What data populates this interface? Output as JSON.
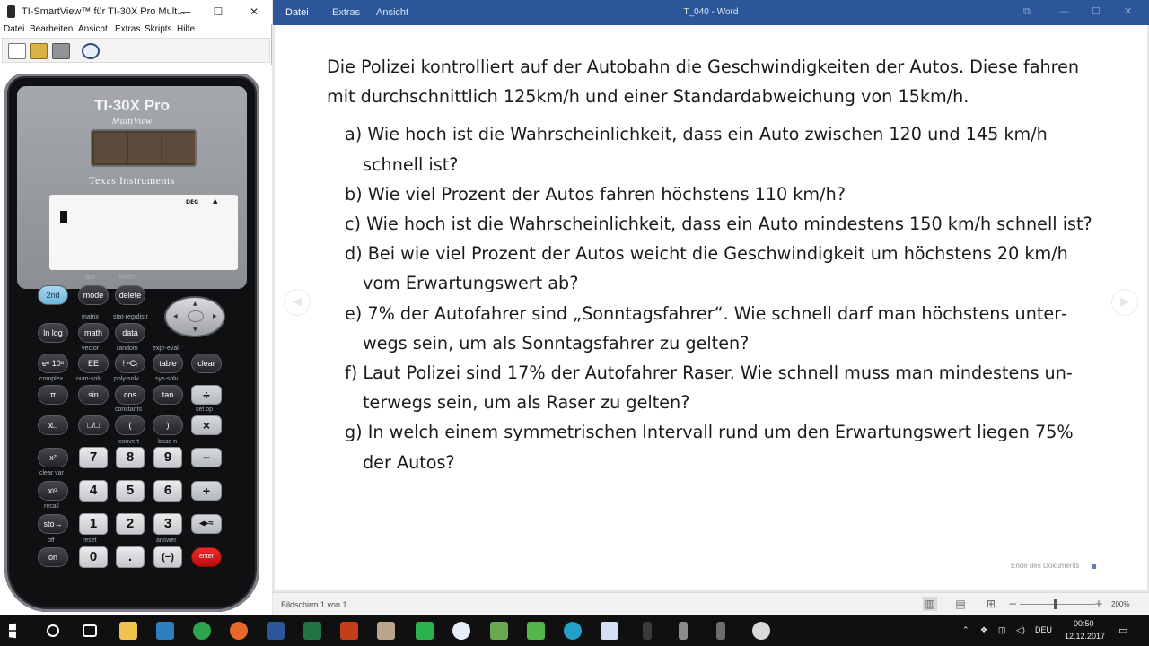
{
  "ti": {
    "title": "TI-SmartView™ für TI-30X Pro Mult...",
    "menus": [
      "Datei",
      "Bearbeiten",
      "Ansicht",
      "Extras",
      "Skripts",
      "Hilfe"
    ],
    "calculator": {
      "model": "TI-30X Pro",
      "submodel": "MultiView",
      "brand": "Texas Instruments",
      "display_mode": "DEG",
      "keys": {
        "k2nd": "2nd",
        "mode": "mode",
        "delete": "delete",
        "ln": "ln log",
        "math": "math",
        "data": "data",
        "exp": "eᵒ 10ᵒ",
        "ee": "EE",
        "table": "table",
        "clear": "clear",
        "pi": "π",
        "sin": "sin",
        "cos": "cos",
        "tan": "tan",
        "divide": "÷",
        "xpow": "x□",
        "frac": "□/□",
        "lparen": "(",
        "rparen": ")",
        "multiply": "×",
        "x2": "x²",
        "n7": "7",
        "n8": "8",
        "n9": "9",
        "minus": "−",
        "xyz": "xʸᶻ",
        "n4": "4",
        "n5": "5",
        "n6": "6",
        "plus": "+",
        "sto": "sto→",
        "n1": "1",
        "n2": "2",
        "n3": "3",
        "toggle": "◂▸≈",
        "on": "on",
        "n0": "0",
        "dot": ".",
        "neg": "(−)",
        "enter": "enter"
      },
      "second_labels": {
        "quit": "quit",
        "insert": "insert",
        "matrix": "matrix",
        "statreg": "stat-reg/distr",
        "vector": "vector",
        "random": "random",
        "expreval": "expr-eval",
        "complex": "complex",
        "numsolv": "num-solv",
        "polysolv": "poly-solv",
        "syssolv": "sys-solv",
        "constants": "constants",
        "setop": "set op",
        "convert": "convert",
        "basen": "base n",
        "clearvar": "clear var",
        "recall": "recall",
        "reset": "reset",
        "answer": "answer",
        "off": "off"
      }
    }
  },
  "word": {
    "tabs": [
      "Datei",
      "Extras",
      "Ansicht"
    ],
    "doc_title": "T_040  -  Word",
    "intro": "Die Polizei kontrolliert auf der Autobahn die Geschwindigkeiten der Autos. Diese fah­ren mit durchschnittlich 125km/h und einer Standardabweichung von 15km/h.",
    "questions": [
      "a) Wie hoch ist die Wahrscheinlichkeit, dass ein Auto zwischen 120 und 145 km/h schnell ist?",
      "b) Wie viel Prozent der Autos fahren höchstens 110 km/h?",
      "c) Wie hoch ist die Wahrscheinlichkeit, dass ein Auto mindestens 150 km/h schnell ist?",
      "d) Bei wie viel Prozent der Autos weicht die Geschwindigkeit um höchstens 20 km/h vom Erwartungswert ab?",
      "e) 7% der Autofahrer sind „Sonntagsfahrer“. Wie schnell darf man höchstens unter­wegs sein, um als Sonntagsfahrer zu gelten?",
      "f) Laut Polizei sind 17% der Autofahrer Raser. Wie schnell muss man mindestens un­terwegs sein, um als Raser zu gelten?",
      "g) In welch einem symmetrischen Intervall rund um den Erwartungswert liegen 75% der Autos?"
    ],
    "end_of_document": "Ende des Dokuments",
    "status": "Bildschirm 1 von 1",
    "zoom": "200%"
  },
  "taskbar": {
    "language": "DEU",
    "time": "00:50",
    "date": "12.12.2017"
  }
}
